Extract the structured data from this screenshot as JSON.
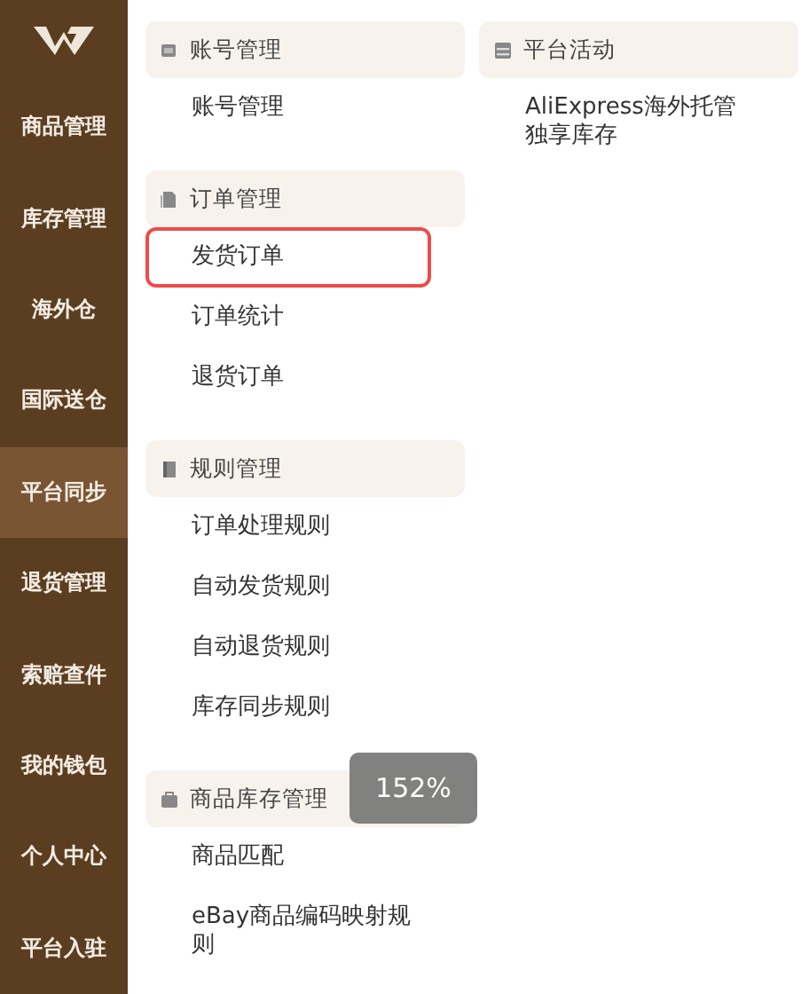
{
  "sidebar": {
    "items": [
      {
        "label": "商品管理",
        "selected": false
      },
      {
        "label": "库存管理",
        "selected": false
      },
      {
        "label": "海外仓",
        "selected": false
      },
      {
        "label": "国际送仓",
        "selected": false
      },
      {
        "label": "平台同步",
        "selected": true
      },
      {
        "label": "退货管理",
        "selected": false
      },
      {
        "label": "索赔查件",
        "selected": false
      },
      {
        "label": "我的钱包",
        "selected": false
      },
      {
        "label": "个人中心",
        "selected": false
      },
      {
        "label": "平台入驻",
        "selected": false
      }
    ]
  },
  "columns": [
    {
      "sections": [
        {
          "title": "账号管理",
          "items": [
            {
              "label": "账号管理",
              "selected": false
            }
          ]
        },
        {
          "title": "订单管理",
          "items": [
            {
              "label": "发货订单",
              "selected": true
            },
            {
              "label": "订单统计",
              "selected": false
            },
            {
              "label": "退货订单",
              "selected": false
            }
          ]
        },
        {
          "title": "规则管理",
          "items": [
            {
              "label": "订单处理规则",
              "selected": false
            },
            {
              "label": "自动发货规则",
              "selected": false
            },
            {
              "label": "自动退货规则",
              "selected": false
            },
            {
              "label": "库存同步规则",
              "selected": false
            }
          ]
        },
        {
          "title": "商品库存管理",
          "items": [
            {
              "label": "商品匹配",
              "selected": false
            },
            {
              "label": "eBay商品编码映射规则",
              "selected": false
            }
          ]
        }
      ]
    },
    {
      "sections": [
        {
          "title": "平台活动",
          "items": [
            {
              "label": "AliExpress海外托管独享库存",
              "selected": false
            }
          ]
        }
      ]
    }
  ],
  "zoom_indicator": {
    "text": "152%"
  }
}
